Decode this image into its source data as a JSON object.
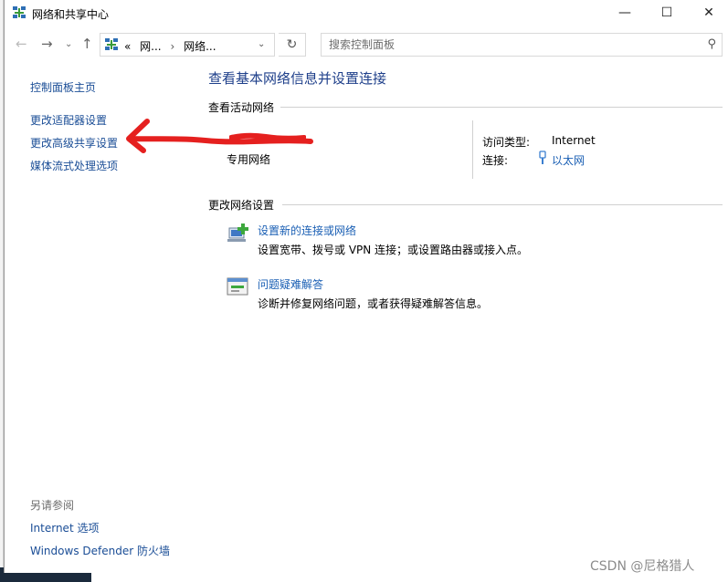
{
  "window": {
    "title": "网络和共享中心",
    "min_glyph": "—",
    "max_glyph": "☐",
    "close_glyph": "✕"
  },
  "nav": {
    "back": "←",
    "forward": "→",
    "recent": "⌄",
    "up": "↑",
    "address": {
      "prefix": "«",
      "crumb1": "网...",
      "sep": "›",
      "crumb2": "网络...",
      "drop": "⌄"
    },
    "refresh": "↻",
    "search_placeholder": "搜索控制面板",
    "search_icon": "⚲"
  },
  "sidebar": {
    "items": [
      {
        "label": "控制面板主页"
      },
      {
        "label": "更改适配器设置"
      },
      {
        "label": "更改高级共享设置"
      },
      {
        "label": "媒体流式处理选项"
      }
    ],
    "see_also_heading": "另请参阅",
    "see_also": [
      {
        "label": "Internet 选项"
      },
      {
        "label": "Windows Defender 防火墙"
      }
    ]
  },
  "main": {
    "title": "查看基本网络信息并设置连接",
    "active_heading": "查看活动网络",
    "network": {
      "profile": "专用网络",
      "access_label": "访问类型:",
      "access_value": "Internet",
      "connection_label": "连接:",
      "connection_value": "以太网"
    },
    "change_heading": "更改网络设置",
    "tasks": [
      {
        "title": "设置新的连接或网络",
        "desc": "设置宽带、拨号或 VPN 连接；或设置路由器或接入点。",
        "icon": "new-connection-icon"
      },
      {
        "title": "问题疑难解答",
        "desc": "诊断并修复网络问题，或者获得疑难解答信息。",
        "icon": "troubleshoot-icon"
      }
    ]
  },
  "annotation": {
    "color": "#e5201f"
  },
  "watermark": "CSDN @尼格猎人",
  "colors": {
    "link": "#1a5fb4",
    "title": "#1e3f8a",
    "sidebar_link": "#1a4d96"
  }
}
